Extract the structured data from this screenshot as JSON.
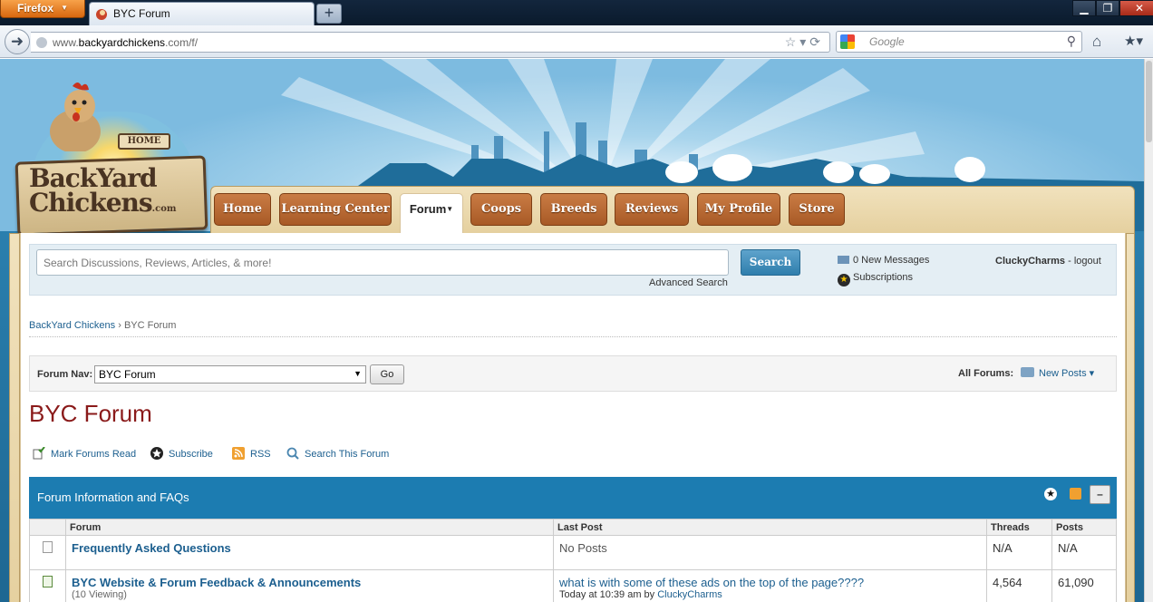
{
  "browser": {
    "app_button": "Firefox",
    "tab_title": "BYC Forum",
    "new_tab": "+",
    "url_prefix": "www.",
    "url_host": "backyardchickens",
    "url_suffix": ".com/f/",
    "search_placeholder": "Google"
  },
  "logo": {
    "line1": "BackYard",
    "line2": "Chickens",
    "suffix": ".com",
    "home_sign": "HOME"
  },
  "nav": {
    "items": [
      {
        "label": "Home"
      },
      {
        "label": "Learning Center"
      },
      {
        "label": "Forum",
        "active": true
      },
      {
        "label": "Coops"
      },
      {
        "label": "Breeds"
      },
      {
        "label": "Reviews"
      },
      {
        "label": "My Profile"
      },
      {
        "label": "Store"
      }
    ]
  },
  "search": {
    "placeholder": "Search Discussions, Reviews, Articles, & more!",
    "button": "Search",
    "advanced": "Advanced Search"
  },
  "user_panel": {
    "messages": "0 New Messages",
    "subscriptions": "Subscriptions",
    "username": "CluckyCharms",
    "separator": " - ",
    "logout": "logout"
  },
  "breadcrumb": {
    "root": "BackYard Chickens",
    "sep": " › ",
    "current": "BYC Forum"
  },
  "forum_nav": {
    "label": "Forum Nav:",
    "selected": "BYC Forum",
    "go": "Go",
    "all_forums": "All Forums:",
    "new_posts": "New Posts"
  },
  "page_title": "BYC Forum",
  "actions": {
    "mark_read": "Mark Forums Read",
    "subscribe": "Subscribe",
    "rss": "RSS",
    "search_forum": "Search This Forum"
  },
  "section": {
    "title": "Forum Information and FAQs",
    "collapse": "–"
  },
  "table": {
    "headers": {
      "forum": "Forum",
      "last_post": "Last Post",
      "threads": "Threads",
      "posts": "Posts"
    },
    "rows": [
      {
        "name": "Frequently Asked Questions",
        "viewing": "",
        "last_post": "No Posts",
        "last_meta": "",
        "threads": "N/A",
        "posts": "N/A"
      },
      {
        "name": "BYC Website & Forum Feedback & Announcements",
        "viewing": "(10 Viewing)",
        "last_post": "what is with some of these ads on the top of the page????",
        "last_meta_prefix": "Today at 10:39 am by ",
        "last_meta_user": "CluckyCharms",
        "threads": "4,564",
        "posts": "61,090"
      }
    ]
  },
  "colors": {
    "accent": "#1c7cb1",
    "nav_button": "#b5652f",
    "title_red": "#8a1a1a",
    "link": "#1c5f8f"
  }
}
